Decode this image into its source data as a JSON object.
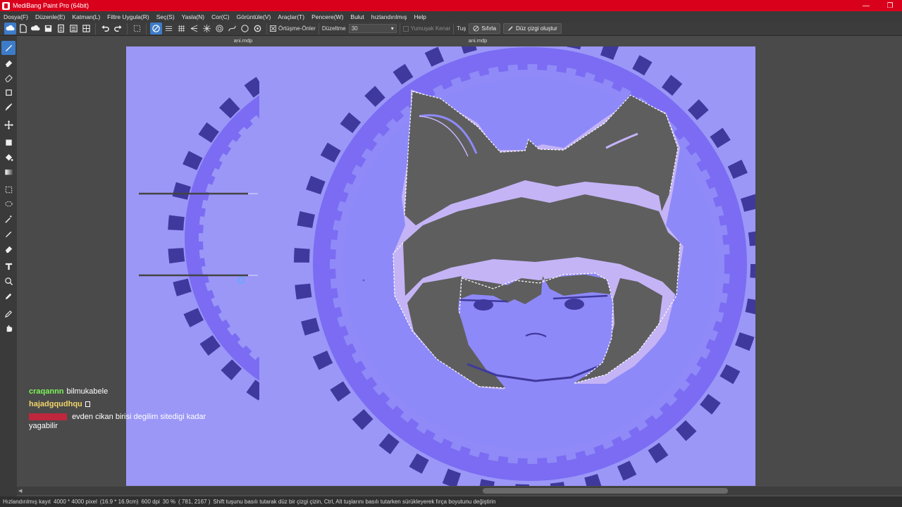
{
  "window": {
    "title": "MediBang Paint Pro (64bit)",
    "restore_glyph": "❐"
  },
  "menu": {
    "items": [
      "Dosya(F)",
      "Düzenle(E)",
      "Katman(L)",
      "Filtre Uygula(R)",
      "Seç(S)",
      "Yasla(N)",
      "Cor(C)",
      "Görüntüle(V)",
      "Araçlar(T)",
      "Pencere(W)",
      "Bulut",
      "hızlandırılmış",
      "Help"
    ]
  },
  "toolbar": {
    "ortusme_label": "Örtüşme-Önler",
    "duzeltme_label": "Düzeltme",
    "duzeltme_value": "30",
    "yumusak_label": "Yumuşak Kenar",
    "tu_label": "Tuş",
    "sifirla_label": "Sıfırla",
    "duz_cizgi_label": "Düz çizgi oluştur"
  },
  "tabs": [
    "ani.mdp",
    "ani.mdp"
  ],
  "chat": {
    "messages": [
      {
        "user": "craqannn",
        "text": "bilmukabele",
        "color": "#7cf55a"
      },
      {
        "user": "hajadgqudhqu",
        "text": "",
        "color": "#f2d469"
      },
      {
        "user": "",
        "text": "evden cikan birisi degilim sitedigi kadar yagabilir",
        "color": "#d4213b"
      }
    ]
  },
  "status": {
    "save": "Hızlandırılmış kayıt",
    "size": "4000 * 4000 pixel",
    "cm": "(16.9 * 16.9cm)",
    "dpi": "600 dpi",
    "zoom": "30 %",
    "coords": "( 781, 2167 )",
    "hint": "Shift tuşunu basılı tutarak düz bir çizgi çizin, Ctrl, Alt tuşlarını basılı tutarken sürükleyerek fırça boyutunu değiştirin"
  },
  "colors": {
    "canvas_bg": "#9b97f7",
    "ring": "#7b6cf3",
    "ring_dark": "#3f399d",
    "character_fill": "#5e5e5e",
    "highlight": "#c7b2f6",
    "titlebar": "#d9001b"
  }
}
